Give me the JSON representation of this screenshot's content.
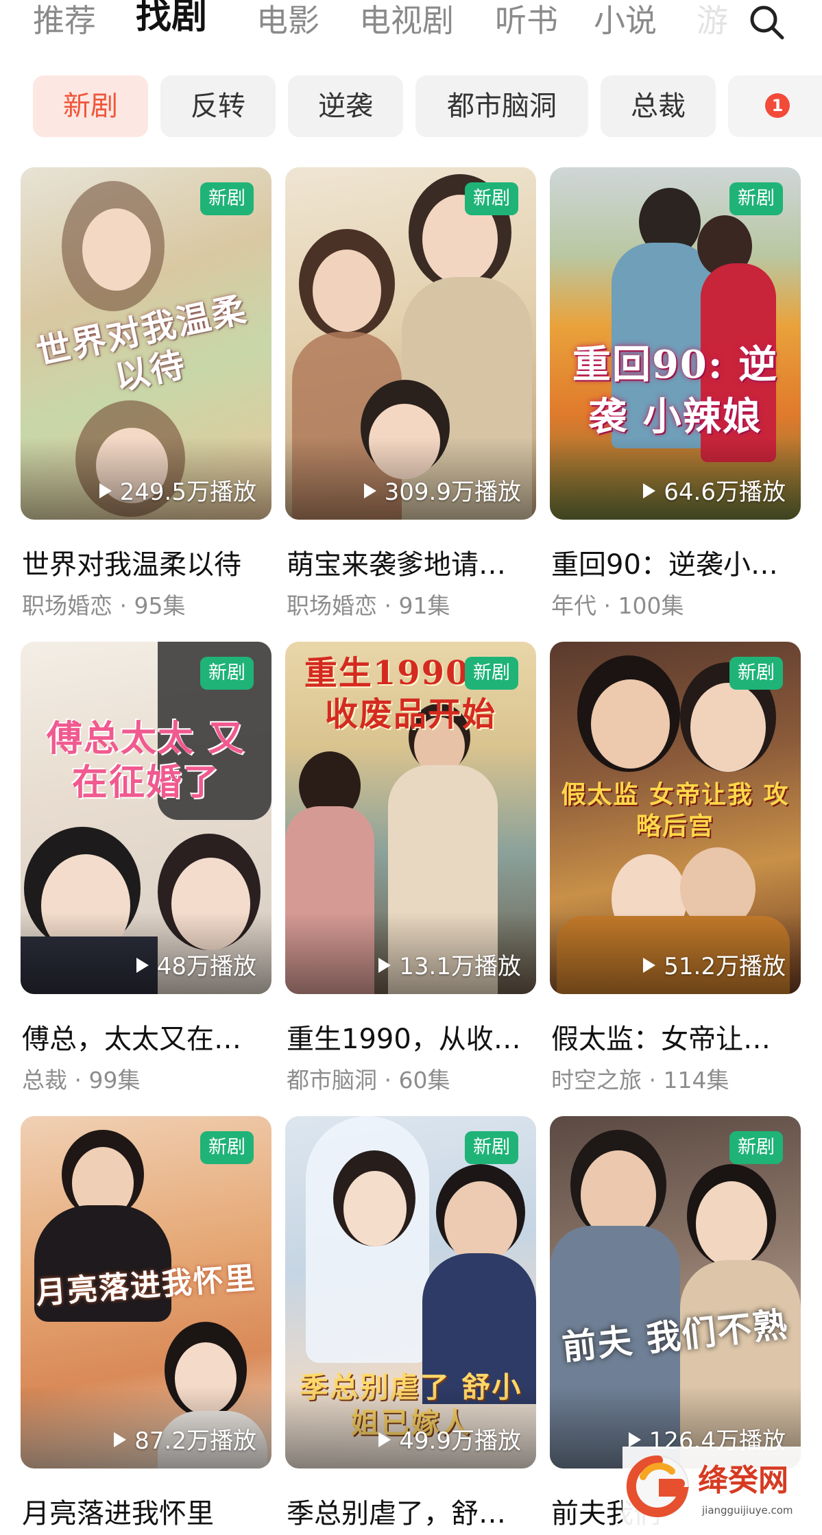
{
  "nav": {
    "tabs": [
      {
        "label": "推荐",
        "active": false
      },
      {
        "label": "找剧",
        "active": true
      },
      {
        "label": "电影",
        "active": false
      },
      {
        "label": "电视剧",
        "active": false
      },
      {
        "label": "听书",
        "active": false
      },
      {
        "label": "小说",
        "active": false
      },
      {
        "label": "游",
        "active": false
      }
    ],
    "search_icon": "search-icon"
  },
  "chips": {
    "items": [
      {
        "label": "新剧",
        "active": true
      },
      {
        "label": "反转",
        "active": false
      },
      {
        "label": "逆袭",
        "active": false
      },
      {
        "label": "都市脑洞",
        "active": false
      },
      {
        "label": "总裁",
        "active": false
      }
    ],
    "badge": "1"
  },
  "badge_label": "新剧",
  "dramas": [
    {
      "title": "世界对我温柔以待",
      "genre": "职场婚恋",
      "episodes": "95集",
      "plays": "249.5万播放",
      "poster_text": "世界对我温柔以待"
    },
    {
      "title": "萌宝来袭爹地请…",
      "genre": "职场婚恋",
      "episodes": "91集",
      "plays": "309.9万播放",
      "poster_text": ""
    },
    {
      "title": "重回90：逆袭小…",
      "genre": "年代",
      "episodes": "100集",
      "plays": "64.6万播放",
      "poster_text": "重回90: 逆袭 小辣娘"
    },
    {
      "title": "傅总，太太又在…",
      "genre": "总裁",
      "episodes": "99集",
      "plays": "48万播放",
      "poster_text": "傅总太太 又在征婚了"
    },
    {
      "title": "重生1990，从收…",
      "genre": "都市脑洞",
      "episodes": "60集",
      "plays": "13.1万播放",
      "poster_text": "重生1990 从收废品开始"
    },
    {
      "title": "假太监：女帝让…",
      "genre": "时空之旅",
      "episodes": "114集",
      "plays": "51.2万播放",
      "poster_text": "假太监 女帝让我 攻略后宫"
    },
    {
      "title": "月亮落进我怀里",
      "genre": "",
      "episodes": "",
      "plays": "87.2万播放",
      "poster_text": "月亮落进我怀里"
    },
    {
      "title": "季总别虐了，舒…",
      "genre": "",
      "episodes": "",
      "plays": "49.9万播放",
      "poster_text": "季总别虐了 舒小姐已嫁人"
    },
    {
      "title": "前夫我们",
      "genre": "",
      "episodes": "",
      "plays": "126.4万播放",
      "poster_text": "前夫 我们不熟"
    }
  ],
  "watermark": {
    "name": "绛癸网",
    "url": "jiangguijiuye.com"
  },
  "colors": {
    "accent": "#f0553a",
    "chip_active_bg": "#fde7e2",
    "new_badge": "#1fb378",
    "notify_badge": "#f24b3a"
  }
}
